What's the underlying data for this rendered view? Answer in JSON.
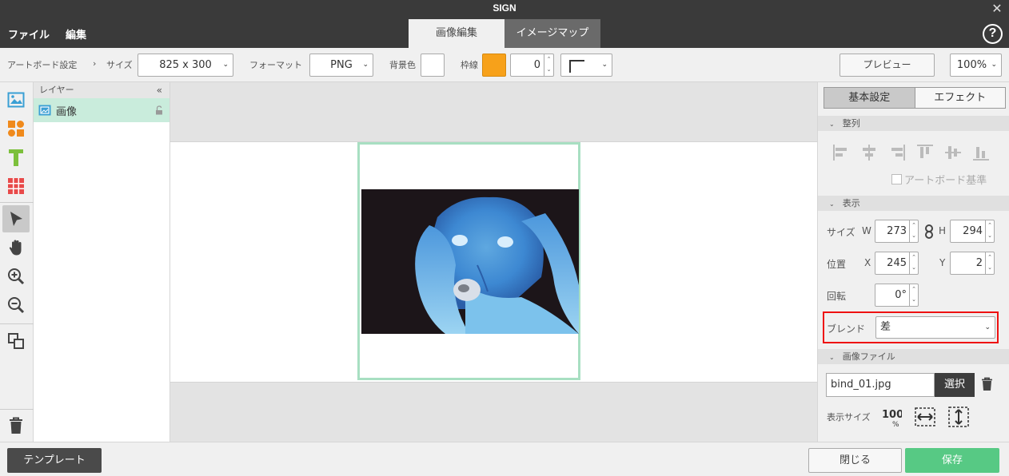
{
  "window": {
    "title": "SIGN",
    "close_glyph": "✕"
  },
  "menu": {
    "file": "ファイル",
    "edit": "編集"
  },
  "mode_tabs": {
    "image_edit": "画像編集",
    "image_map": "イメージマップ"
  },
  "help_glyph": "?",
  "toolbar": {
    "artboard_settings": "アートボード設定",
    "breadcrumb_sep": "›",
    "size_label": "サイズ",
    "size_value": "825 x 300",
    "format_label": "フォーマット",
    "format_value": "PNG",
    "bg_label": "背景色",
    "border_label": "枠線",
    "border_value": "0",
    "preview": "プレビュー",
    "zoom": "100%"
  },
  "layers": {
    "title": "レイヤー",
    "collapse": "«",
    "items": [
      {
        "label": "画像"
      }
    ]
  },
  "props": {
    "tabs": {
      "basic": "基本設定",
      "effect": "エフェクト"
    },
    "sections": {
      "align": "整列",
      "display": "表示",
      "image_file": "画像ファイル"
    },
    "artboard_base": "アートボード基準",
    "size_label": "サイズ",
    "w_label": "W",
    "w_value": "273",
    "h_label": "H",
    "h_value": "294",
    "pos_label": "位置",
    "x_label": "X",
    "x_value": "245",
    "y_label": "Y",
    "y_value": "2",
    "rotation_label": "回転",
    "rotation_value": "0°",
    "blend_label": "ブレンド",
    "blend_value": "差",
    "file_name": "bind_01.jpg",
    "select_button": "選択",
    "display_size_label": "表示サイズ"
  },
  "bottom": {
    "template": "テンプレート",
    "close": "閉じる",
    "save": "保存"
  },
  "colors": {
    "border_swatch": "#f7a11a",
    "accent_green": "#57c984",
    "selection": "#a8dfc2"
  }
}
